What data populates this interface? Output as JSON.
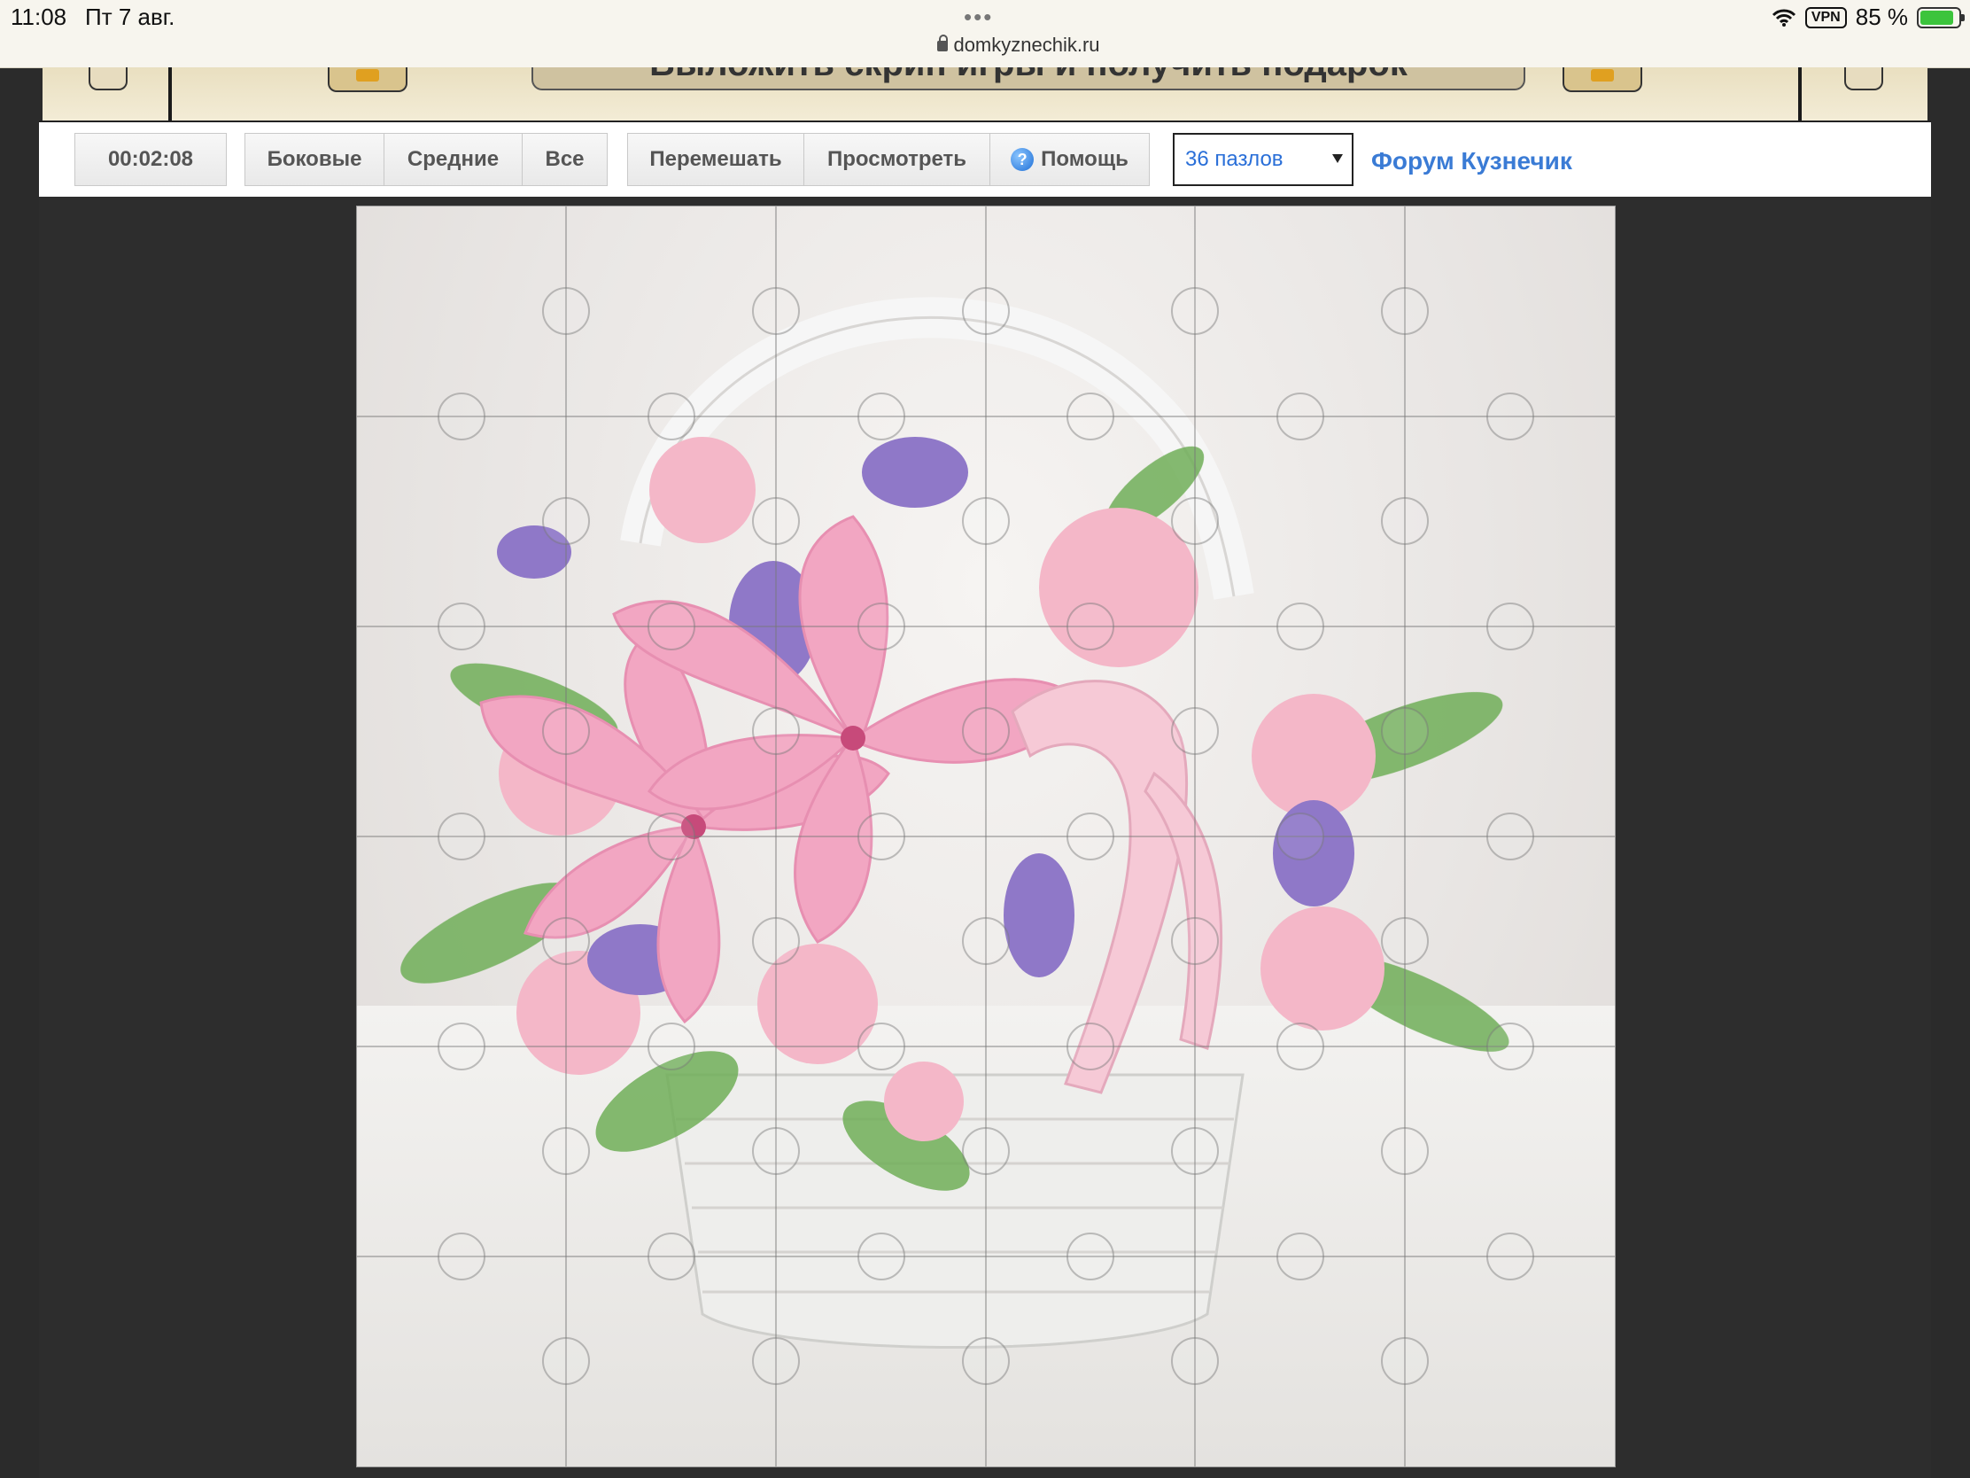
{
  "status_bar": {
    "time": "11:08",
    "date": "Пт 7 авг.",
    "dots": "•••",
    "url": "domkyznechik.ru",
    "vpn": "VPN",
    "battery": "85 %"
  },
  "banner": {
    "text": "Выложить скрин игры и получить подарок"
  },
  "toolbar": {
    "timer": "00:02:08",
    "filter_buttons": [
      "Боковые",
      "Средние",
      "Все"
    ],
    "action_buttons": {
      "shuffle": "Перемешать",
      "preview": "Просмотреть",
      "help": "Помощь"
    },
    "help_icon_glyph": "?",
    "pieces_select": "36 пазлов",
    "forum_link": "Форум Кузнечик"
  },
  "puzzle": {
    "grid": "6 x 6",
    "image_subject": "pink lily bouquet in white basket"
  },
  "colors": {
    "link": "#3a7bd5",
    "select_text": "#2a6fd8",
    "background": "#2b2b2b"
  }
}
